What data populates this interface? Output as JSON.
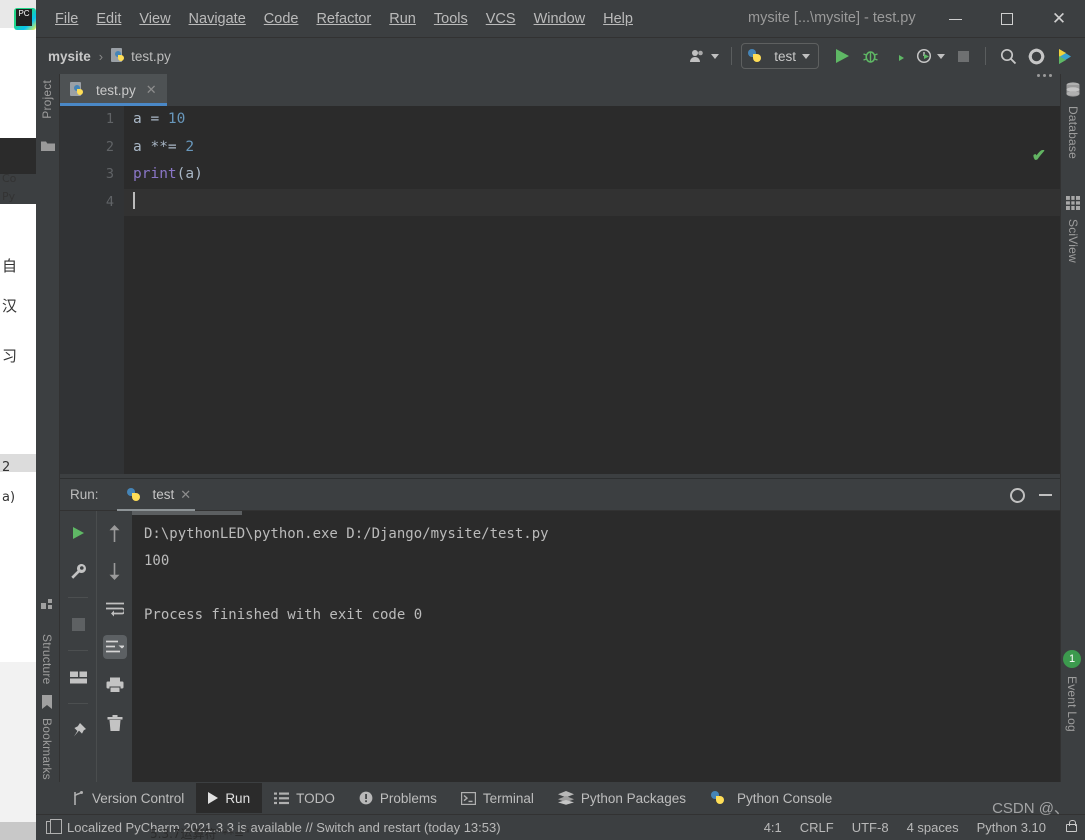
{
  "window": {
    "title": "mysite [...\\mysite] - test.py",
    "minimize": "—",
    "maximize": "□",
    "close": "✕"
  },
  "menubar": {
    "items": [
      {
        "label": "File"
      },
      {
        "label": "Edit"
      },
      {
        "label": "View"
      },
      {
        "label": "Navigate"
      },
      {
        "label": "Code"
      },
      {
        "label": "Refactor"
      },
      {
        "label": "Run"
      },
      {
        "label": "Tools"
      },
      {
        "label": "VCS"
      },
      {
        "label": "Window"
      },
      {
        "label": "Help"
      }
    ]
  },
  "navbar": {
    "project": "mysite",
    "separator": "›",
    "file": "test.py",
    "run_config": "test",
    "icons": {
      "profile": "profile-icon",
      "run": "run-icon",
      "debug": "debug-icon",
      "coverage": "coverage-icon",
      "profiler": "profiler-icon",
      "stop": "stop-icon",
      "search": "search-icon",
      "settings": "settings-icon",
      "plugin": "plugin-icon"
    }
  },
  "left_stripe": {
    "project": "Project",
    "structure": "Structure",
    "bookmarks": "Bookmarks"
  },
  "right_stripe": {
    "database": "Database",
    "sciview": "SciView",
    "event_log": "Event Log",
    "event_log_count": "1"
  },
  "editor": {
    "tab": "test.py",
    "tab_close": "✕",
    "line_numbers": [
      "1",
      "2",
      "3",
      "4"
    ],
    "code": [
      {
        "text": "a = 10",
        "tokens": [
          {
            "t": "a = ",
            "c": "plain"
          },
          {
            "t": "10",
            "c": "num"
          }
        ]
      },
      {
        "text": "a **= 2",
        "tokens": [
          {
            "t": "a **= ",
            "c": "plain"
          },
          {
            "t": "2",
            "c": "num"
          }
        ]
      },
      {
        "text": "print(a)",
        "tokens": [
          {
            "t": "print",
            "c": "fn"
          },
          {
            "t": "(a)",
            "c": "plain"
          }
        ]
      },
      {
        "text": "",
        "tokens": []
      }
    ],
    "inspection_status": "✔"
  },
  "run_window": {
    "label": "Run:",
    "tab": "test",
    "tab_close": "✕",
    "console": [
      "D:\\pythonLED\\python.exe D:/Django/mysite/test.py",
      "100",
      "",
      "Process finished with exit code 0"
    ],
    "toolbar_left": [
      "rerun-icon",
      "wrench-icon",
      "stop-icon",
      "layout-icon",
      "pin-icon"
    ],
    "toolbar_right": [
      "up-arrow-icon",
      "down-arrow-icon",
      "soft-wrap-icon",
      "scroll-to-end-icon",
      "print-icon",
      "trash-icon"
    ],
    "header_icons": [
      "settings-icon",
      "hide-icon"
    ]
  },
  "bottom_tabs": [
    {
      "label": "Version Control",
      "icon": "branch-icon",
      "active": false
    },
    {
      "label": "Run",
      "icon": "run-icon",
      "active": true
    },
    {
      "label": "TODO",
      "icon": "list-icon",
      "active": false
    },
    {
      "label": "Problems",
      "icon": "warning-icon",
      "active": false
    },
    {
      "label": "Terminal",
      "icon": "terminal-icon",
      "active": false
    },
    {
      "label": "Python Packages",
      "icon": "packages-icon",
      "active": false
    },
    {
      "label": "Python Console",
      "icon": "python-icon",
      "active": false
    }
  ],
  "statusbar": {
    "message": "Localized PyCharm 2021.3.3 is available // Switch and restart (today 13:53)",
    "caret_position": "4:1",
    "line_separator": "CRLF",
    "encoding": "UTF-8",
    "indent": "4 spaces",
    "interpreter": "Python 3.10",
    "lock_icon": "lock-icon"
  },
  "watermark": {
    "text": "CSDN @、",
    "bottom_text": "5.3.7运算符\"**=\""
  },
  "colors": {
    "frame": "#3c3f41",
    "editor_bg": "#2b2b2b",
    "accent_blue": "#4a88c7",
    "run_green": "#5fb865",
    "badge_green": "#3c9a4e",
    "text": "#bbbbbb",
    "number_token": "#6897bb",
    "function_token": "#8a76c7"
  }
}
